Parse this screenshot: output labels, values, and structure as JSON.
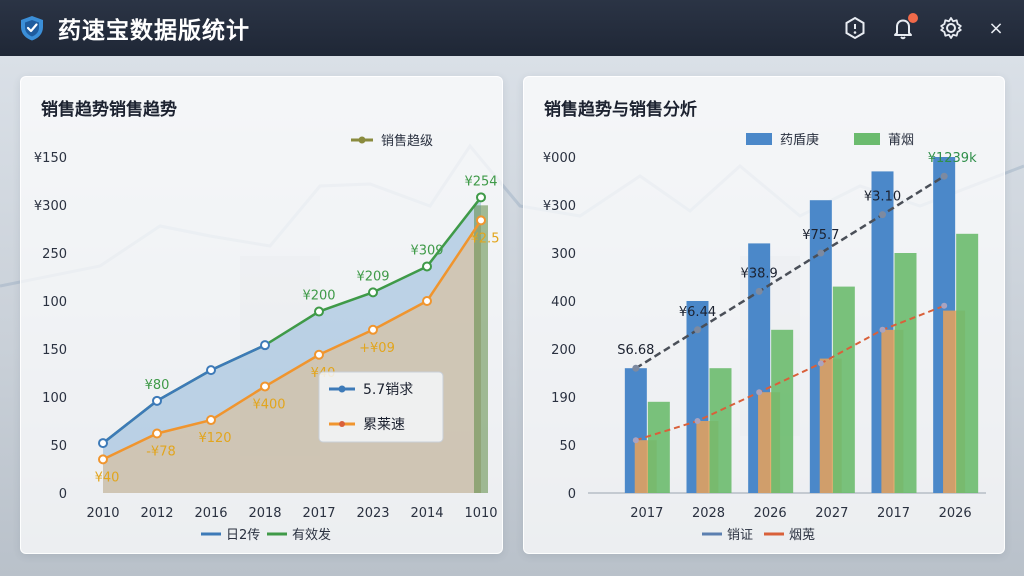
{
  "app": {
    "title": "药速宝数据版统计",
    "icons": [
      "shield-logo-icon",
      "hexagon-icon",
      "bell-icon",
      "gear-icon",
      "close-icon"
    ],
    "close_glyph": "×"
  },
  "colors": {
    "topbar": "#232c3b",
    "blue": "#3d7ab8",
    "green": "#3f9a48",
    "orange": "#f0952e",
    "bar_blue": "#4b88c9",
    "bar_green": "#6bbb6e",
    "bar_orange": "#e8a25a"
  },
  "chart_data": [
    {
      "type": "line",
      "title": "销售趋势销售趋势",
      "categories": [
        "2010",
        "2012",
        "2016",
        "2018",
        "2017",
        "2023",
        "2014",
        "1010"
      ],
      "y_ticks": [
        "0",
        "50",
        "100",
        "150",
        "100",
        "250",
        "¥300",
        "¥150"
      ],
      "ylim": [
        0,
        350
      ],
      "grid": false,
      "legend_top": "销售趋级",
      "legend_box": [
        "5.7销求",
        "累莱速"
      ],
      "legend_bottom": [
        "日2传",
        "有效发"
      ],
      "series": [
        {
          "name": "5.7销求",
          "values": [
            52,
            96,
            128,
            154,
            189,
            209,
            236,
            308
          ],
          "labels": [
            "",
            "¥80",
            "",
            "",
            "¥200",
            "¥209",
            "¥309",
            "¥254"
          ]
        },
        {
          "name": "累莱速",
          "values": [
            35,
            62,
            76,
            111,
            144,
            170,
            200,
            284
          ],
          "labels": [
            "¥40",
            "-¥78",
            "¥120",
            "¥400",
            "¥40",
            "+¥09",
            "",
            "¥2.5"
          ]
        }
      ]
    },
    {
      "type": "bar",
      "title": "销售趋势与销售分炘",
      "categories": [
        "2017",
        "2028",
        "2026",
        "2027",
        "2017",
        "2026"
      ],
      "y_ticks": [
        "0",
        "50",
        "190",
        "200",
        "400",
        "300",
        "¥300",
        "¥000"
      ],
      "ylim": [
        0,
        350
      ],
      "legend_top": [
        "药盾庚",
        "莆烟"
      ],
      "legend_bottom": [
        "销证",
        "烟莵"
      ],
      "series": [
        {
          "name": "药盾庚",
          "values": [
            130,
            200,
            260,
            305,
            335,
            350
          ]
        },
        {
          "name": "莆烟",
          "values": [
            95,
            130,
            170,
            215,
            250,
            270
          ]
        }
      ],
      "overlay": [
        55,
        75,
        105,
        140,
        170,
        190
      ],
      "trend_upper": {
        "values": [
          130,
          170,
          210,
          250,
          290,
          330
        ],
        "labels": [
          "S6.68",
          "¥6.44",
          "¥38.9",
          "¥75.7",
          "¥3.10",
          "¥1239k"
        ]
      },
      "trend_lower": {
        "values": [
          55,
          75,
          105,
          135,
          170,
          195
        ]
      }
    }
  ]
}
